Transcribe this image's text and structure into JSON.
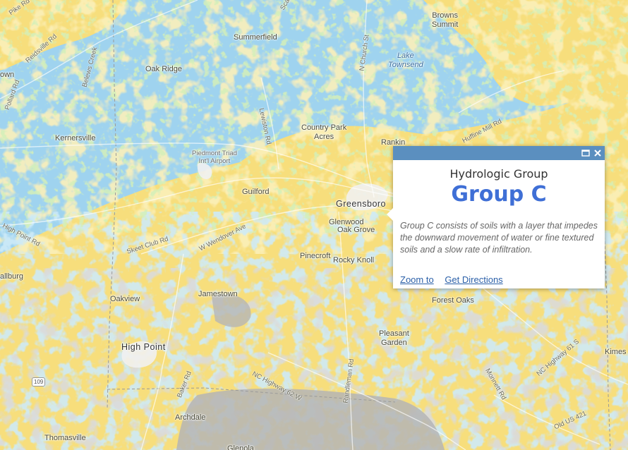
{
  "map": {
    "colors": {
      "group_a": "#a8df7d",
      "group_b": "#9fd3ef",
      "group_c": "#f7de7c",
      "group_d": "#b5b5b5",
      "urban": "#f1f1f1",
      "road": "#ffffff",
      "county_line": "#9a9a9a"
    },
    "places": {
      "browns_summit": "Browns\nSummit",
      "summerfield": "Summerfield",
      "oak_ridge": "Oak Ridge",
      "lake_townsend": "Lake\nTownsend",
      "kernersville": "Kernersville",
      "country_park_acres": "Country Park\nAcres",
      "rankin": "Rankin",
      "piedmont_triad_airport": "Piedmont Triad\nInt'l Airport",
      "guilford": "Guilford",
      "greensboro": "Greensboro",
      "glenwood": "Glenwood",
      "oak_grove": "Oak Grove",
      "pinecroft": "Pinecroft",
      "rocky_knoll": "Rocky Knoll",
      "wallburg": "allburg",
      "town_left": "own",
      "oakview": "Oakview",
      "jamestown": "Jamestown",
      "forest_oaks": "Forest Oaks",
      "pleasant_garden": "Pleasant\nGarden",
      "high_point": "High Point",
      "kimes": "Kimes",
      "archdale": "Archdale",
      "thomasville": "Thomasville",
      "glenola": "Glenola"
    },
    "roads": {
      "pike_rd": "Pike Rd",
      "reidsville_rd": "Reidsville Rd",
      "belews_creek": "Belews Creek",
      "pollard_rd": "Pollard Rd",
      "lewiston_rd": "Lewiston Rd",
      "n_church_st": "N Church St",
      "huffine_mill": "Huffine Mill Rd",
      "high_point_rd": "High Point Rd",
      "skeet_club_rd": "Skeet Club Rd",
      "w_wendover_ave": "W Wendover Ave",
      "rankin_rd": "Randleman Rd",
      "nc_highway_62": "NC Highway 62 W",
      "baker_rd": "Baker Rd",
      "monnett_rd": "Monnett Rd",
      "nc_highway_61": "NC Highway 61 S",
      "old_us_421": "Old US 421",
      "scalesville": "Scalesville"
    },
    "shield_109": "109"
  },
  "popup": {
    "heading": "Hydrologic Group",
    "value": "Group C",
    "description": "Group C consists of soils with a layer that impedes the downward movement of water or fine textured soils and a slow rate of infiltration.",
    "actions": {
      "zoom_to": "Zoom to",
      "get_directions": "Get Directions"
    },
    "icons": {
      "maximize": "maximize-icon",
      "close": "close-icon"
    }
  }
}
